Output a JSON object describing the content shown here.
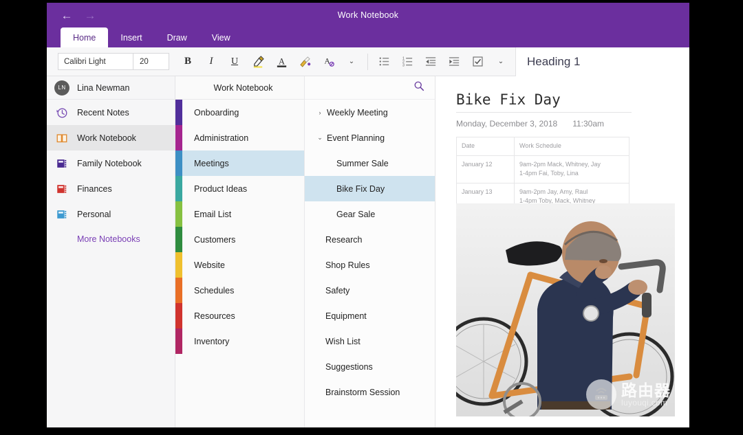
{
  "window": {
    "title": "Work Notebook",
    "back_icon": "back-arrow-icon",
    "forward_icon": "forward-arrow-icon",
    "back_glyph": "←",
    "forward_glyph": "→",
    "accent": "#6b2f9e"
  },
  "ribbon": {
    "tabs": [
      {
        "label": "Home",
        "active": true
      },
      {
        "label": "Insert",
        "active": false
      },
      {
        "label": "Draw",
        "active": false
      },
      {
        "label": "View",
        "active": false
      }
    ]
  },
  "toolbar": {
    "font_name": "Calibri Light",
    "font_size": "20",
    "bold": "B",
    "italic": "I",
    "underline": "U",
    "highlight_icon": "highlighter-icon",
    "font_color_icon": "font-color-icon",
    "format_painter_icon": "format-painter-icon",
    "clear_formatting_icon": "clear-formatting-icon",
    "more_font_chevron": "chevron-down-icon",
    "bullets_icon": "bulleted-list-icon",
    "numbering_icon": "numbered-list-icon",
    "decrease_indent_icon": "decrease-indent-icon",
    "increase_indent_icon": "increase-indent-icon",
    "todo_icon": "checkbox-tag-icon",
    "more_para_chevron": "chevron-down-icon",
    "style_name": "Heading 1",
    "chevron_glyph": "⌄"
  },
  "sidebar": {
    "user": {
      "initials": "LN",
      "name": "Lina Newman",
      "avatar_name": "avatar"
    },
    "items": [
      {
        "label": "Recent Notes",
        "icon": "recent-clock-icon",
        "color": "#7a4fb5",
        "selected": false
      },
      {
        "label": "Work Notebook",
        "icon": "open-book-icon",
        "color": "#e08b31",
        "selected": true
      },
      {
        "label": "Family Notebook",
        "icon": "notebook-icon",
        "color": "#4a2a91",
        "selected": false
      },
      {
        "label": "Finances",
        "icon": "notebook-icon",
        "color": "#d0332e",
        "selected": false
      },
      {
        "label": "Personal",
        "icon": "notebook-icon",
        "color": "#3d9ad1",
        "selected": false
      }
    ],
    "more_notebooks": "More Notebooks"
  },
  "sections": {
    "header": "Work Notebook",
    "search_icon": "search-icon",
    "items": [
      {
        "label": "Onboarding",
        "color": "#512f9b",
        "selected": false
      },
      {
        "label": "Administration",
        "color": "#a5258f",
        "selected": false
      },
      {
        "label": "Meetings",
        "color": "#3d8fc4",
        "selected": true
      },
      {
        "label": "Product Ideas",
        "color": "#3aa8a0",
        "selected": false
      },
      {
        "label": "Email List",
        "color": "#86c141",
        "selected": false
      },
      {
        "label": "Customers",
        "color": "#2f8c3f",
        "selected": false
      },
      {
        "label": "Website",
        "color": "#efc02e",
        "selected": false
      },
      {
        "label": "Schedules",
        "color": "#e96f26",
        "selected": false
      },
      {
        "label": "Resources",
        "color": "#d0332e",
        "selected": false
      },
      {
        "label": "Inventory",
        "color": "#b02663",
        "selected": false
      }
    ]
  },
  "pages": {
    "items": [
      {
        "label": "Weekly Meeting",
        "level": 0,
        "caret": "collapsed",
        "selected": false
      },
      {
        "label": "Event Planning",
        "level": 0,
        "caret": "expanded",
        "selected": false
      },
      {
        "label": "Summer Sale",
        "level": 1,
        "caret": "none",
        "selected": false
      },
      {
        "label": "Bike Fix Day",
        "level": 1,
        "caret": "none",
        "selected": true
      },
      {
        "label": "Gear Sale",
        "level": 1,
        "caret": "none",
        "selected": false
      },
      {
        "label": "Research",
        "level": 0,
        "caret": "none",
        "selected": false
      },
      {
        "label": "Shop Rules",
        "level": 0,
        "caret": "none",
        "selected": false
      },
      {
        "label": "Safety",
        "level": 0,
        "caret": "none",
        "selected": false
      },
      {
        "label": "Equipment",
        "level": 0,
        "caret": "none",
        "selected": false
      },
      {
        "label": "Wish List",
        "level": 0,
        "caret": "none",
        "selected": false
      },
      {
        "label": "Suggestions",
        "level": 0,
        "caret": "none",
        "selected": false
      },
      {
        "label": "Brainstorm Session",
        "level": 0,
        "caret": "none",
        "selected": false
      }
    ],
    "caret_collapsed_glyph": "›",
    "caret_expanded_glyph": "⌄"
  },
  "note": {
    "title": "Bike Fix Day",
    "date": "Monday, December 3, 2018",
    "time": "11:30am",
    "table": {
      "headers": [
        "Date",
        "Work Schedule"
      ],
      "rows": [
        [
          "January 12",
          "9am-2pm Mack, Whitney, Jay\n1-4pm Fai, Toby, Lina"
        ],
        [
          "January 13",
          "9am-2pm Jay, Amy, Raul\n1-4pm Toby, Mack, Whitney"
        ]
      ]
    },
    "image_alt": "man carrying orange bicycle on shoulder"
  },
  "watermark": {
    "cn": "路由器",
    "en": "luyouqi.com",
    "icon": "router-icon"
  }
}
